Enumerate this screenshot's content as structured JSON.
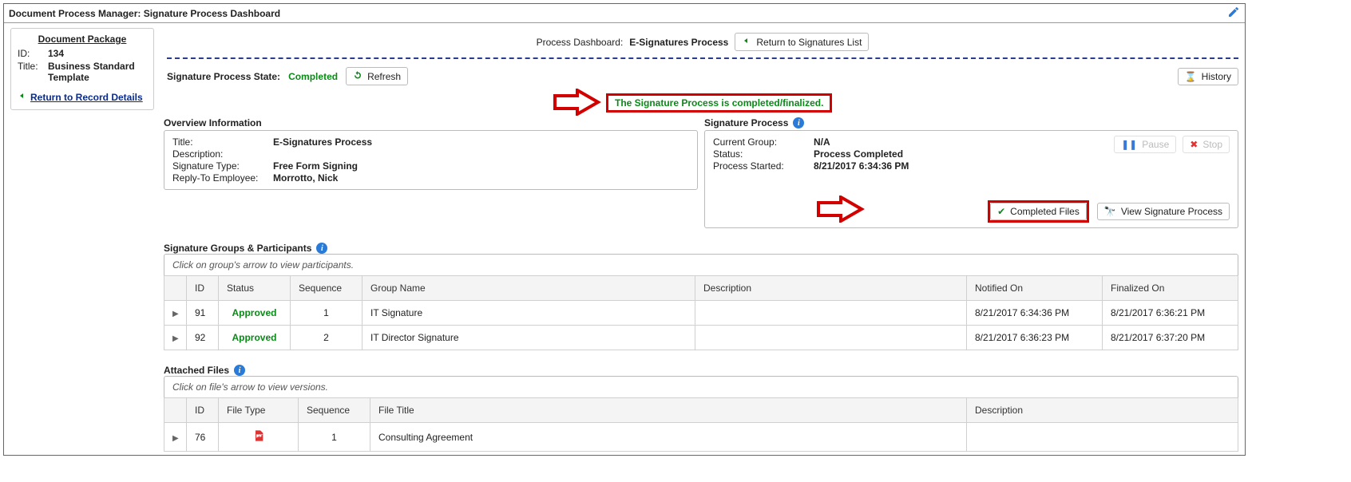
{
  "titlebar": {
    "title": "Document Process Manager: Signature Process Dashboard"
  },
  "doc": {
    "package_label": "Document Package",
    "id_label": "ID:",
    "id": "134",
    "title_label": "Title:",
    "title": "Business Standard Template",
    "return_label": "Return to Record Details"
  },
  "dashboard": {
    "label": "Process Dashboard:",
    "process_name": "E-Signatures Process",
    "return_list_btn": "Return to Signatures List"
  },
  "state": {
    "label": "Signature Process State:",
    "value": "Completed",
    "refresh_btn": "Refresh",
    "history_btn": "History"
  },
  "message": {
    "text": "The Signature Process is completed/finalized."
  },
  "overview": {
    "heading": "Overview Information",
    "title_label": "Title:",
    "title": "E-Signatures Process",
    "desc_label": "Description:",
    "desc": "",
    "sigtype_label": "Signature Type:",
    "sigtype": "Free Form Signing",
    "reply_label": "Reply-To Employee:",
    "reply": "Morrotto, Nick"
  },
  "sigproc": {
    "heading": "Signature Process",
    "pause_btn": "Pause",
    "stop_btn": "Stop",
    "group_label": "Current Group:",
    "group": "N/A",
    "status_label": "Status:",
    "status": "Process Completed",
    "started_label": "Process Started:",
    "started": "8/21/2017 6:34:36 PM",
    "completed_files_btn": "Completed Files",
    "view_proc_btn": "View Signature Process"
  },
  "groups": {
    "heading": "Signature Groups & Participants",
    "hint": "Click on group's arrow to view participants.",
    "headers": {
      "id": "ID",
      "status": "Status",
      "seq": "Sequence",
      "name": "Group Name",
      "desc": "Description",
      "notified": "Notified On",
      "finalized": "Finalized On"
    },
    "rows": [
      {
        "id": "91",
        "status": "Approved",
        "seq": "1",
        "name": "IT Signature",
        "desc": "",
        "notified": "8/21/2017 6:34:36 PM",
        "finalized": "8/21/2017 6:36:21 PM"
      },
      {
        "id": "92",
        "status": "Approved",
        "seq": "2",
        "name": "IT Director Signature",
        "desc": "",
        "notified": "8/21/2017 6:36:23 PM",
        "finalized": "8/21/2017 6:37:20 PM"
      }
    ]
  },
  "files": {
    "heading": "Attached Files",
    "hint": "Click on file's arrow to view versions.",
    "headers": {
      "id": "ID",
      "type": "File Type",
      "seq": "Sequence",
      "title": "File Title",
      "desc": "Description"
    },
    "rows": [
      {
        "id": "76",
        "type": "pdf",
        "seq": "1",
        "title": "Consulting Agreement",
        "desc": ""
      }
    ]
  }
}
